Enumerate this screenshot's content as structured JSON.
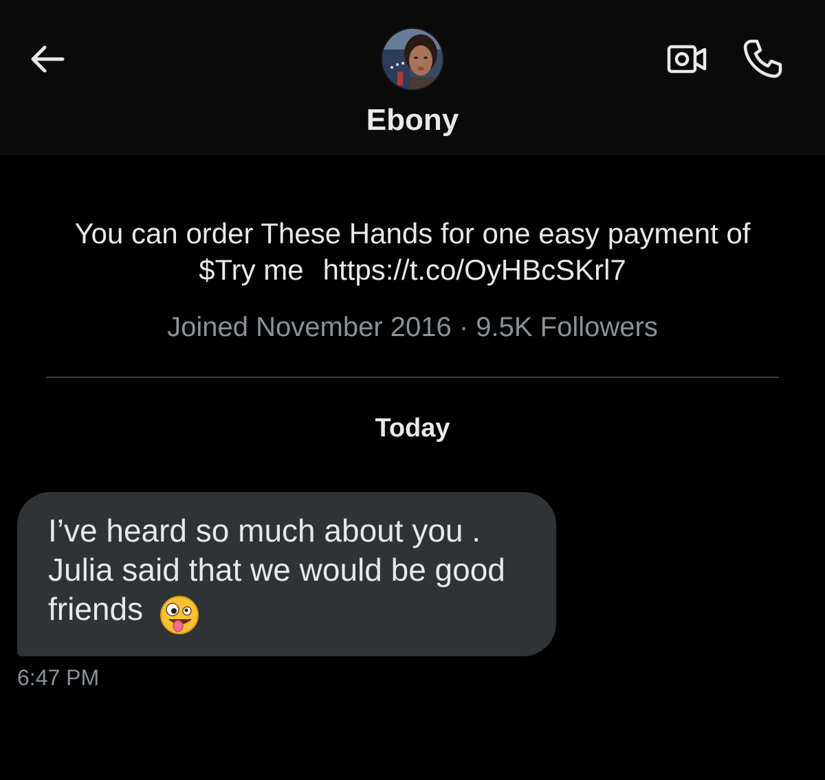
{
  "header": {
    "name": "Ebony",
    "avatar_icon": "profile-avatar",
    "back_icon": "back-arrow-icon",
    "video_icon": "video-camera-icon",
    "call_icon": "phone-icon"
  },
  "profile": {
    "bio_line1": "You can order These Hands for one easy payment of",
    "bio_line2_text": "$Try me",
    "bio_link": "https://t.co/OyHBcSKrl7",
    "meta": "Joined November 2016 · 9.5K Followers"
  },
  "conversation": {
    "day_label": "Today",
    "messages": [
      {
        "text": "I’ve heard so much about you .\nJulia said that we would be good\nfriends",
        "emoji": "zany-face-emoji",
        "time": "6:47 PM"
      }
    ]
  },
  "colors": {
    "background": "#000000",
    "header_bg": "#0b0b0b",
    "bubble": "#2f3336",
    "primary_text": "#e7e9ea",
    "secondary_text": "#8b9197",
    "divider": "#3a3d42"
  }
}
